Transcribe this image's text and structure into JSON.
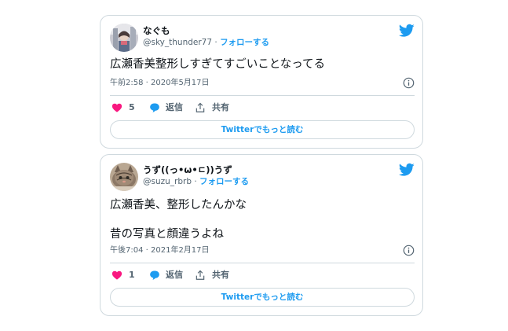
{
  "tweets": [
    {
      "display_name": "なぐも",
      "handle": "@sky_thunder77",
      "separator": "·",
      "follow_label": "フォローする",
      "text_lines": [
        "広瀬香美整形しすぎてすごいことなってる"
      ],
      "timestamp": "午前2:58 · 2020年5月17日",
      "like_count": "5",
      "reply_label": "返信",
      "share_label": "共有",
      "read_more_label": "Twitterでもっと読む"
    },
    {
      "display_name": "うず((っ•ω•ㄷ))うず",
      "handle": "@suzu_rbrb",
      "separator": "·",
      "follow_label": "フォローする",
      "text_lines": [
        "広瀬香美、整形したんかな",
        "昔の写真と顔違うよね"
      ],
      "timestamp": "午後7:04 · 2021年2月17日",
      "like_count": "1",
      "reply_label": "返信",
      "share_label": "共有",
      "read_more_label": "Twitterでもっと読む"
    }
  ],
  "colors": {
    "accent": "#1d9bf0",
    "like": "#f91880",
    "text": "#0f1419",
    "secondary": "#536471",
    "border": "#cfd9de"
  },
  "icons": [
    "twitter-bird-icon",
    "info-icon",
    "heart-icon",
    "reply-bubble-icon",
    "share-icon"
  ]
}
